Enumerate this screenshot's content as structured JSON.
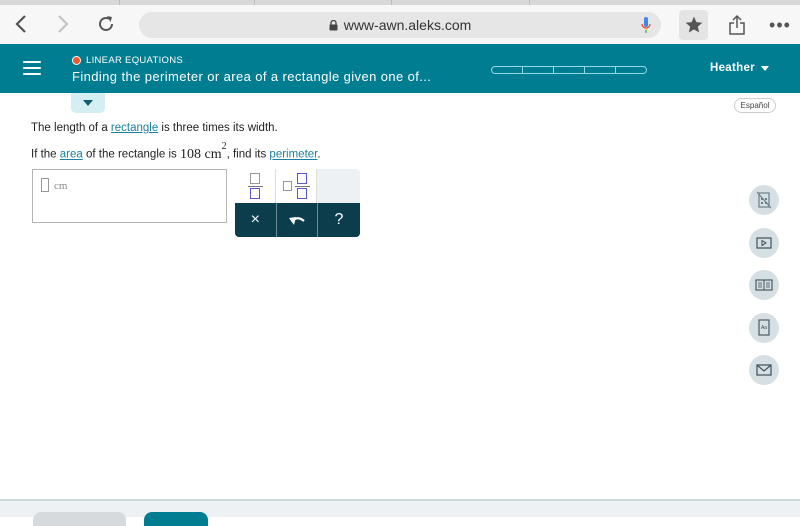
{
  "browser": {
    "url": "www-awn.aleks.com",
    "back_icon": "chevron-left-icon",
    "forward_icon": "chevron-right-icon",
    "reload_icon": "reload-icon",
    "more_label": "•••"
  },
  "header": {
    "topic": "LINEAR EQUATIONS",
    "title": "Finding the perimeter or area of a rectangle given one of...",
    "progress_segments": 5,
    "progress_filled": 0,
    "user_name": "Heather",
    "accent_color": "#017d92",
    "topic_dot_color": "#ea5c2c"
  },
  "language_button": "Español",
  "question": {
    "line1_pre": "The length of a ",
    "line1_link": "rectangle",
    "line1_post": " is three times its width.",
    "line2_pre": "If the ",
    "line2_link1": "area",
    "line2_mid": " of the rectangle is ",
    "value": "108",
    "unit": "cm",
    "exponent": "2",
    "line2_post": ", find its ",
    "line2_link2": "perimeter",
    "line2_end": "."
  },
  "answer": {
    "value": "",
    "unit": "cm"
  },
  "keypad": {
    "clear_label": "×",
    "undo_icon": "undo-icon",
    "help_label": "?"
  },
  "tools": [
    "calculator-disabled-icon",
    "video-icon",
    "ebook-icon",
    "dictionary-icon",
    "message-icon"
  ]
}
